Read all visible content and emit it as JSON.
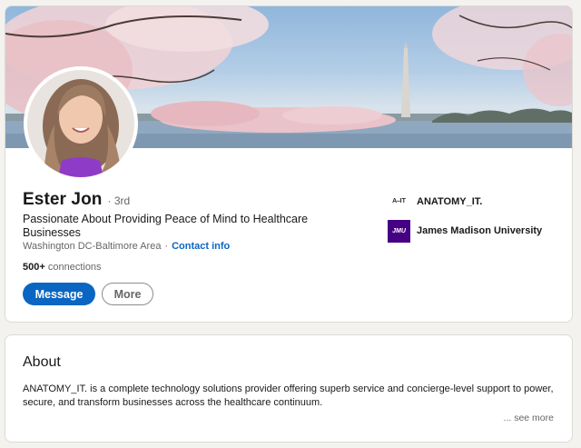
{
  "profile": {
    "name": "Ester Jon",
    "degree": "· 3rd",
    "headline": "Passionate About Providing Peace of Mind to Healthcare Businesses",
    "location": "Washington DC-Baltimore Area",
    "location_separator": "·",
    "contact_info_label": "Contact info",
    "connections_count": "500+",
    "connections_label": "connections",
    "message_button": "Message",
    "more_button": "More"
  },
  "experience": [
    {
      "logo_text": "A⎯IT",
      "name": "ANATOMY_IT."
    },
    {
      "logo_text": "JMU",
      "name": "James Madison University"
    }
  ],
  "about": {
    "title": "About",
    "body": "ANATOMY_IT. is a complete technology solutions provider offering superb service and concierge-level support to power, secure, and transform businesses across the healthcare continuum.",
    "see_more": "... see more"
  },
  "colors": {
    "accent": "#0a66c2",
    "page_background": "#f3f2ef",
    "jmu_purple": "#450084"
  }
}
